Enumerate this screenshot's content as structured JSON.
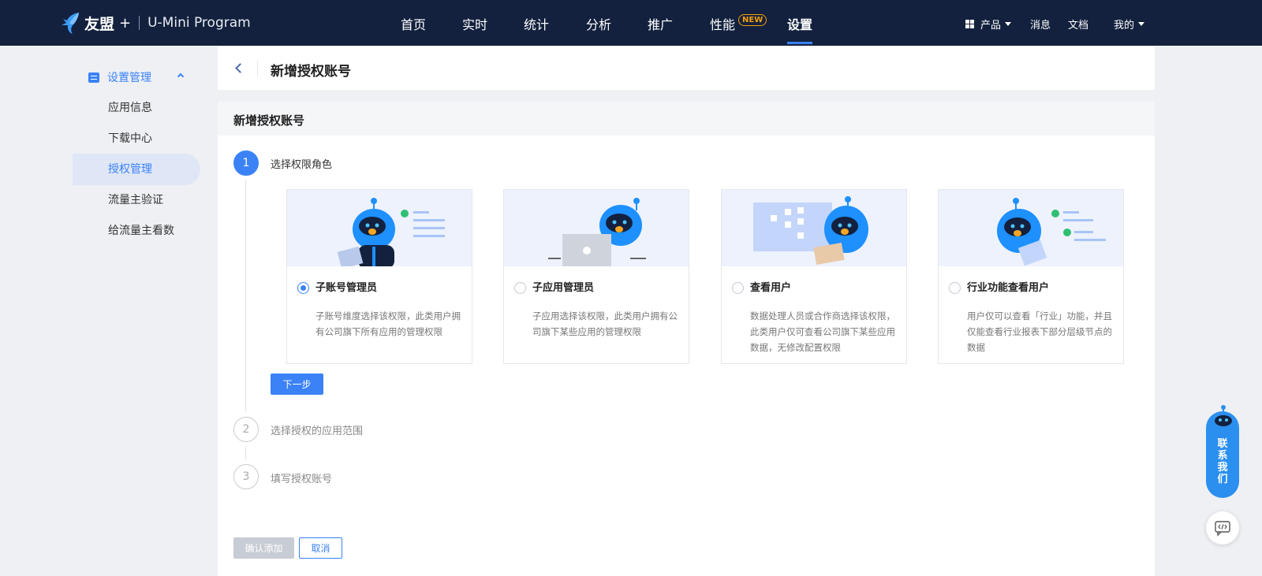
{
  "logo": {
    "brand": "友盟",
    "plus": "+",
    "program": "U-Mini Program"
  },
  "nav": {
    "items": [
      {
        "label": "首页"
      },
      {
        "label": "实时"
      },
      {
        "label": "统计"
      },
      {
        "label": "分析"
      },
      {
        "label": "推广"
      },
      {
        "label": "性能"
      },
      {
        "label": "设置"
      }
    ],
    "active": "设置",
    "new_badge": "NEW",
    "right": {
      "product": "产品",
      "messages": "消息",
      "docs": "文档",
      "mine": "我的"
    }
  },
  "sidebar": {
    "group": "设置管理",
    "items": [
      {
        "label": "应用信息"
      },
      {
        "label": "下载中心"
      },
      {
        "label": "授权管理"
      },
      {
        "label": "流量主验证"
      },
      {
        "label": "给流量主看数"
      }
    ],
    "active": "授权管理"
  },
  "header": {
    "title": "新增授权账号"
  },
  "main": {
    "title": "新增授权账号",
    "steps": [
      {
        "num": "1",
        "label": "选择权限角色"
      },
      {
        "num": "2",
        "label": "选择授权的应用范围"
      },
      {
        "num": "3",
        "label": "填写授权账号"
      }
    ],
    "roles": [
      {
        "name": "子账号管理员",
        "desc": "子账号维度选择该权限，此类用户拥有公司旗下所有应用的管理权限"
      },
      {
        "name": "子应用管理员",
        "desc": "子应用选择该权限，此类用户拥有公司旗下某些应用的管理权限"
      },
      {
        "name": "查看用户",
        "desc": "数据处理人员或合作商选择该权限，此类用户仅可查看公司旗下某些应用数据，无修改配置权限"
      },
      {
        "name": "行业功能查看用户",
        "desc": "用户仅可以查看「行业」功能，并且仅能查看行业报表下部分层级节点的数据"
      }
    ],
    "selected_role": "子账号管理员",
    "next_label": "下一步",
    "confirm_label": "确认添加",
    "cancel_label": "取消"
  },
  "contact": {
    "label": "联系我们"
  },
  "colors": {
    "nav_bg": "#13213e",
    "accent": "#3b82f6",
    "new_badge": "#f59e0b",
    "contact_bg": "#2b8ff0"
  }
}
